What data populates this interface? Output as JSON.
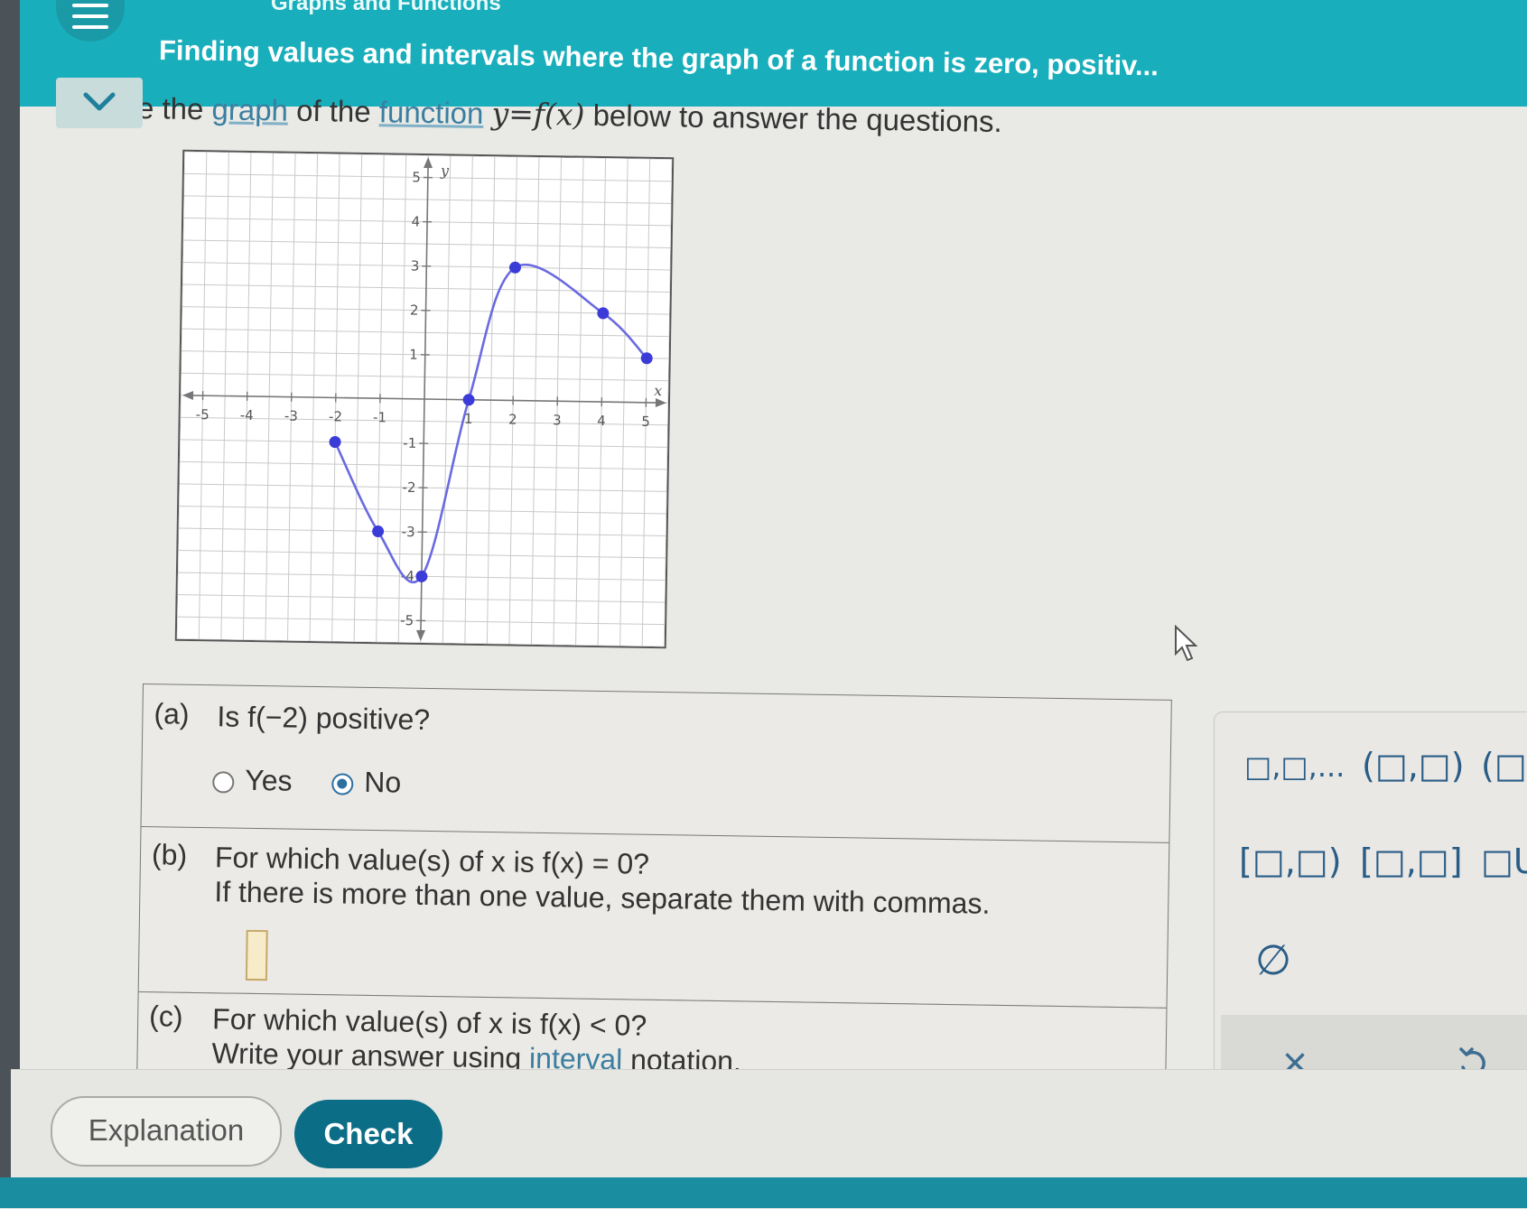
{
  "header": {
    "breadcrumb": "Graphs and Functions",
    "title": "Finding values and intervals where the graph of a function is zero, positiv..."
  },
  "instruction": {
    "prefix": "e the ",
    "link_graph": "graph",
    "middle": " of the ",
    "link_function": "function",
    "math": "y=f(x)",
    "suffix": " below to answer the questions."
  },
  "graph": {
    "y_axis_label": "y",
    "x_axis_label": "x",
    "x_ticks": [
      "-5",
      "-4",
      "-3",
      "-2",
      "-1",
      "1",
      "2",
      "3",
      "4",
      "5"
    ],
    "y_ticks": [
      "5",
      "4",
      "3",
      "2",
      "1",
      "-1",
      "-2",
      "-3",
      "-4",
      "-5"
    ],
    "curve_color": "#6a6ae0",
    "point_color": "#3b3bd8"
  },
  "chart_data": {
    "type": "line",
    "x": [
      -2,
      -1,
      0,
      1,
      2,
      4,
      5
    ],
    "y": [
      -1,
      -3,
      -4,
      0,
      3,
      2,
      1
    ],
    "xlim": [
      -5.5,
      5.5
    ],
    "ylim": [
      -5.5,
      5.5
    ],
    "grid": true,
    "marked_points": [
      [
        -2,
        -1
      ],
      [
        -1,
        -3
      ],
      [
        0,
        -4
      ],
      [
        1,
        0
      ],
      [
        2,
        3
      ],
      [
        4,
        2
      ],
      [
        5,
        1
      ]
    ]
  },
  "questions": {
    "a": {
      "label": "(a)",
      "text": "Is f(−2) positive?",
      "options": [
        "Yes",
        "No"
      ],
      "selected": "No"
    },
    "b": {
      "label": "(b)",
      "text": "For which value(s) of x is f(x) = 0?",
      "text2": "If there is more than one value, separate them with commas.",
      "answer": ""
    },
    "c": {
      "label": "(c)",
      "text": "For which value(s) of x is f(x) < 0?",
      "text2_prefix": "Write your answer using ",
      "text2_link": "interval",
      "text2_suffix": " notation."
    }
  },
  "palette": {
    "list": "□,□,...",
    "open_open": "(□,□)",
    "open_partial": "(□,",
    "closed_open": "[□,□)",
    "closed_closed": "[□,□]",
    "union": "□U",
    "empty_set": "∅",
    "clear": "×"
  },
  "buttons": {
    "explanation": "Explanation",
    "check": "Check"
  }
}
